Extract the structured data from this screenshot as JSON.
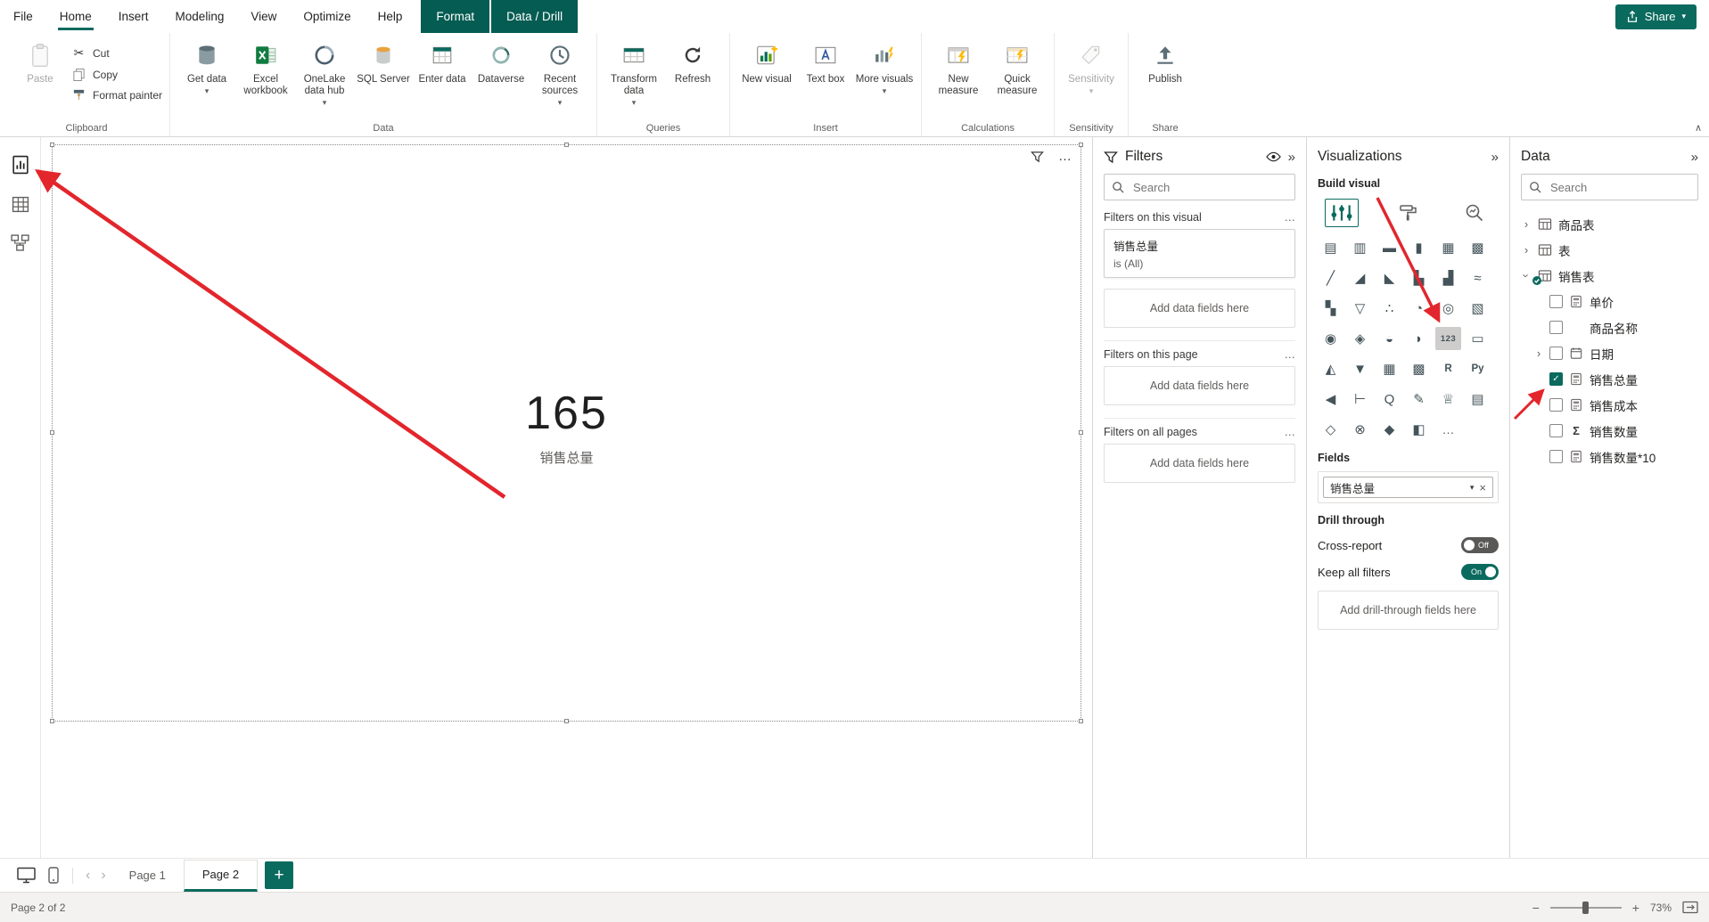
{
  "colors": {
    "accent": "#0b6a5e",
    "accent_dark": "#055c52",
    "red": "#e2262c",
    "text": "#252423",
    "muted": "#605e5c",
    "border": "#e1dfdd"
  },
  "menu": {
    "items": [
      {
        "label": "File"
      },
      {
        "label": "Home",
        "selected": true
      },
      {
        "label": "Insert"
      },
      {
        "label": "Modeling"
      },
      {
        "label": "View"
      },
      {
        "label": "Optimize"
      },
      {
        "label": "Help"
      }
    ],
    "contextual_tabs": [
      {
        "label": "Format"
      },
      {
        "label": "Data / Drill"
      }
    ],
    "share_label": "Share"
  },
  "ribbon": {
    "clipboard": {
      "label": "Clipboard",
      "paste": "Paste",
      "cut": "Cut",
      "copy": "Copy",
      "format_painter": "Format painter"
    },
    "data": {
      "label": "Data",
      "get_data": "Get data",
      "excel": "Excel workbook",
      "onelake": "OneLake data hub",
      "sql": "SQL Server",
      "enter": "Enter data",
      "dataverse": "Dataverse",
      "recent": "Recent sources"
    },
    "queries": {
      "label": "Queries",
      "transform": "Transform data",
      "refresh": "Refresh"
    },
    "insert_group": {
      "label": "Insert",
      "new_visual": "New visual",
      "text_box": "Text box",
      "more_visuals": "More visuals"
    },
    "calculations": {
      "label": "Calculations",
      "new_measure": "New measure",
      "quick_measure": "Quick measure"
    },
    "sensitivity": {
      "label": "Sensitivity",
      "button": "Sensitivity"
    },
    "share_group": {
      "label": "Share",
      "publish": "Publish"
    }
  },
  "canvas": {
    "card_value": "165",
    "card_label": "销售总量"
  },
  "filters": {
    "title": "Filters",
    "search_placeholder": "Search",
    "sections": [
      {
        "label": "Filters on this visual"
      },
      {
        "label": "Filters on this page"
      },
      {
        "label": "Filters on all pages"
      }
    ],
    "card": {
      "name": "销售总量",
      "condition": "is (All)"
    },
    "add_fields": "Add data fields here"
  },
  "viz": {
    "title": "Visualizations",
    "build_label": "Build visual",
    "visual_types": [
      {
        "name": "Stacked bar chart",
        "glyph": "▤"
      },
      {
        "name": "Stacked column chart",
        "glyph": "▥"
      },
      {
        "name": "Clustered bar chart",
        "glyph": "▬"
      },
      {
        "name": "Clustered column chart",
        "glyph": "▮"
      },
      {
        "name": "100% stacked bar chart",
        "glyph": "▦"
      },
      {
        "name": "100% stacked column chart",
        "glyph": "▩"
      },
      {
        "name": "Line chart",
        "glyph": "╱"
      },
      {
        "name": "Area chart",
        "glyph": "◢"
      },
      {
        "name": "Stacked area chart",
        "glyph": "◣"
      },
      {
        "name": "Line and stacked column chart",
        "glyph": "▙"
      },
      {
        "name": "Line and clustered column chart",
        "glyph": "▟"
      },
      {
        "name": "Ribbon chart",
        "glyph": "≈"
      },
      {
        "name": "Waterfall chart",
        "glyph": "▚"
      },
      {
        "name": "Funnel",
        "glyph": "▽"
      },
      {
        "name": "Scatter chart",
        "glyph": "∴"
      },
      {
        "name": "Pie chart",
        "glyph": "◔"
      },
      {
        "name": "Donut chart",
        "glyph": "◎"
      },
      {
        "name": "Treemap",
        "glyph": "▧"
      },
      {
        "name": "Map",
        "glyph": "◉"
      },
      {
        "name": "Filled map",
        "glyph": "◈"
      },
      {
        "name": "Azure map",
        "glyph": "◒"
      },
      {
        "name": "Gauge",
        "glyph": "◗"
      },
      {
        "name": "Card",
        "glyph": "123",
        "selected": true
      },
      {
        "name": "Multi-row card",
        "glyph": "▭"
      },
      {
        "name": "KPI",
        "glyph": "◭"
      },
      {
        "name": "Slicer",
        "glyph": "▼"
      },
      {
        "name": "Table",
        "glyph": "▦"
      },
      {
        "name": "Matrix",
        "glyph": "▩"
      },
      {
        "name": "R script visual",
        "glyph": "R"
      },
      {
        "name": "Python visual",
        "glyph": "Py"
      },
      {
        "name": "Key influencers",
        "glyph": "◀"
      },
      {
        "name": "Decomposition tree",
        "glyph": "⊢"
      },
      {
        "name": "Q&A",
        "glyph": "Q"
      },
      {
        "name": "Smart narrative",
        "glyph": "✎"
      },
      {
        "name": "Metrics",
        "glyph": "♕"
      },
      {
        "name": "Paginated report",
        "glyph": "▤"
      },
      {
        "name": "Power Apps for Power BI",
        "glyph": "◇"
      },
      {
        "name": "Power Automate for Power BI",
        "glyph": "⊗"
      },
      {
        "name": "ArcGIS Maps for Power BI",
        "glyph": "◆"
      },
      {
        "name": "Shape map",
        "glyph": "◧"
      },
      {
        "name": "More visuals",
        "glyph": "…"
      }
    ],
    "fields_label": "Fields",
    "field_pill": "销售总量",
    "drill_label": "Drill through",
    "cross_report": "Cross-report",
    "keep_filters": "Keep all filters",
    "toggle_off": "Off",
    "toggle_on": "On",
    "add_drill": "Add drill-through fields here"
  },
  "data_pane": {
    "title": "Data",
    "search_placeholder": "Search",
    "tables": [
      {
        "name": "商品表"
      },
      {
        "name": "表"
      },
      {
        "name": "销售表",
        "expanded": true
      }
    ],
    "fields": [
      {
        "name": "单价",
        "icon": "measure"
      },
      {
        "name": "商品名称",
        "icon": "none"
      },
      {
        "name": "日期",
        "icon": "calendar",
        "expandable": true
      },
      {
        "name": "销售总量",
        "icon": "measure",
        "checked": true
      },
      {
        "name": "销售成本",
        "icon": "measure"
      },
      {
        "name": "销售数量",
        "icon": "sigma"
      },
      {
        "name": "销售数量*10",
        "icon": "measure"
      }
    ]
  },
  "pagebar": {
    "pages": [
      {
        "label": "Page 1"
      },
      {
        "label": "Page 2",
        "selected": true
      }
    ]
  },
  "status": {
    "page_info": "Page 2 of 2",
    "zoom": "73%"
  },
  "icons": {
    "chevron_down": "▾",
    "chevron_right": "›",
    "collapse": "»",
    "collapse_ribbon": "∧",
    "ellipsis": "…",
    "close": "×",
    "check": "✓",
    "scissors": "✂",
    "sigma": "Σ",
    "nav_left": "‹",
    "nav_right": "›",
    "minus": "−",
    "plus": "+"
  }
}
